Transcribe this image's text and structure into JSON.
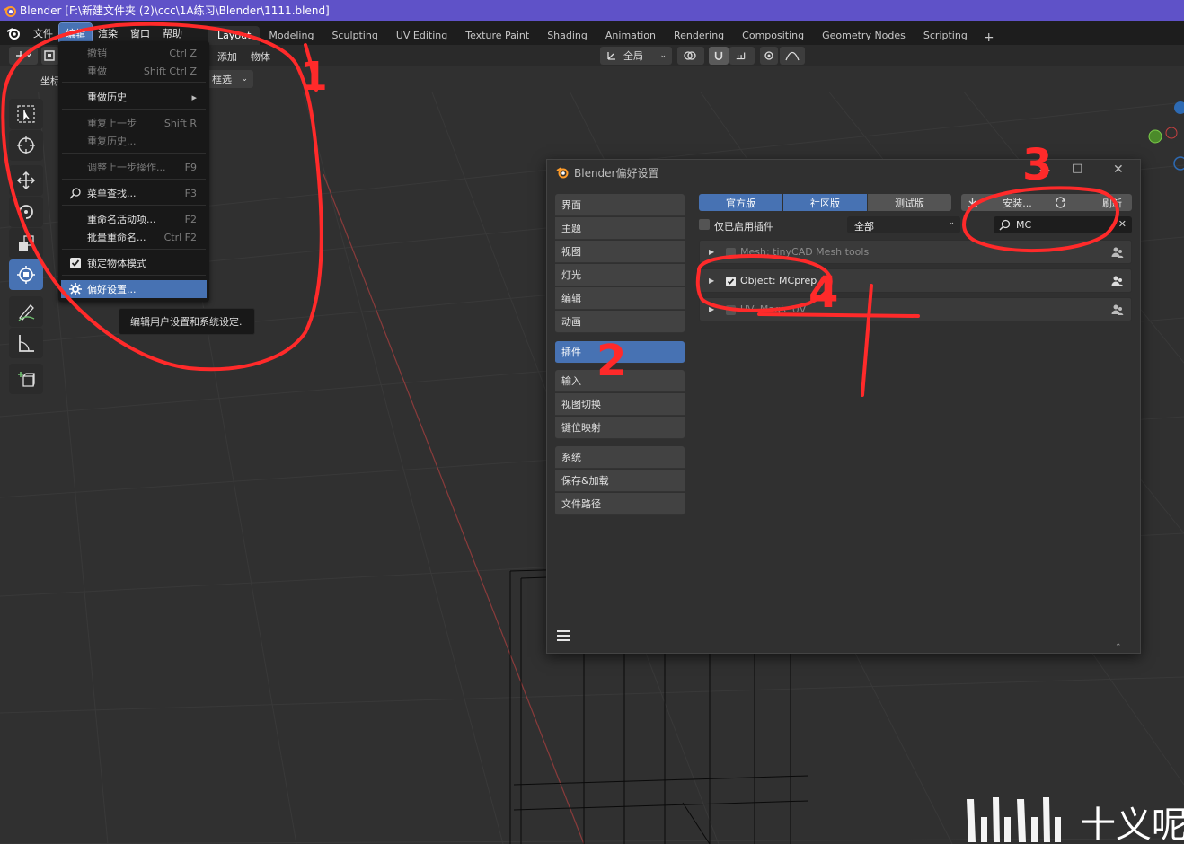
{
  "titlebar": {
    "title": "Blender [F:\\新建文件夹 (2)\\ccc\\1A练习\\Blender\\1111.blend]"
  },
  "topbar": {
    "menus": [
      "文件",
      "编辑",
      "渲染",
      "窗口",
      "帮助"
    ],
    "active_menu": "编辑",
    "workspaces": [
      "Layout",
      "Modeling",
      "Sculpting",
      "UV Editing",
      "Texture Paint",
      "Shading",
      "Animation",
      "Rendering",
      "Compositing",
      "Geometry Nodes",
      "Scripting"
    ],
    "active_workspace": "Layout",
    "add_label": "+"
  },
  "viewport_header": {
    "add": "添加",
    "object": "物体",
    "coords": "坐标",
    "select_box": "框选",
    "transform_orient": "全局"
  },
  "edit_menu": {
    "items": [
      {
        "label": "撤销",
        "shortcut": "Ctrl Z",
        "disabled": true
      },
      {
        "label": "重做",
        "shortcut": "Shift Ctrl Z",
        "disabled": true
      },
      {
        "label": "重做历史",
        "shortcut": "▸",
        "disabled": false
      },
      {
        "label": "重复上一步",
        "shortcut": "Shift R",
        "disabled": true
      },
      {
        "label": "重复历史...",
        "shortcut": "",
        "disabled": true
      },
      {
        "label": "调整上一步操作...",
        "shortcut": "F9",
        "disabled": true
      },
      {
        "label": "菜单查找...",
        "shortcut": "F3",
        "disabled": false
      },
      {
        "label": "重命名活动项...",
        "shortcut": "F2",
        "disabled": false
      },
      {
        "label": "批量重命名...",
        "shortcut": "Ctrl F2",
        "disabled": false
      },
      {
        "label": "锁定物体模式",
        "shortcut": "",
        "disabled": false
      },
      {
        "label": "偏好设置...",
        "shortcut": "",
        "disabled": false
      }
    ],
    "tooltip": "编辑用户设置和系统设定."
  },
  "prefs": {
    "title": "Blender偏好设置",
    "nav_groups": [
      [
        "界面",
        "主题",
        "视图",
        "灯光",
        "编辑",
        "动画"
      ],
      [
        "插件"
      ],
      [
        "输入",
        "视图切换",
        "键位映射"
      ],
      [
        "系统",
        "保存&加载",
        "文件路径"
      ]
    ],
    "selected_nav": "插件",
    "tabs": [
      "官方版",
      "社区版",
      "测试版"
    ],
    "tabs_on": [
      "官方版",
      "社区版"
    ],
    "install_label": "安装...",
    "refresh_label": "刷新",
    "enabled_only_label": "仅已启用插件",
    "category": "全部",
    "search_value": "MC",
    "addons": [
      {
        "name": "Mesh: tinyCAD Mesh tools",
        "enabled": false
      },
      {
        "name": "Object: MCprep",
        "enabled": true
      },
      {
        "name": "UV: Magic UV",
        "enabled": false
      }
    ]
  },
  "annotations": [
    "1",
    "2",
    "3",
    "4"
  ],
  "watermark": "十义呢",
  "colors": {
    "accent": "#4772b3",
    "titlebar": "#5f52c8",
    "annotation": "#ff2a2a"
  }
}
